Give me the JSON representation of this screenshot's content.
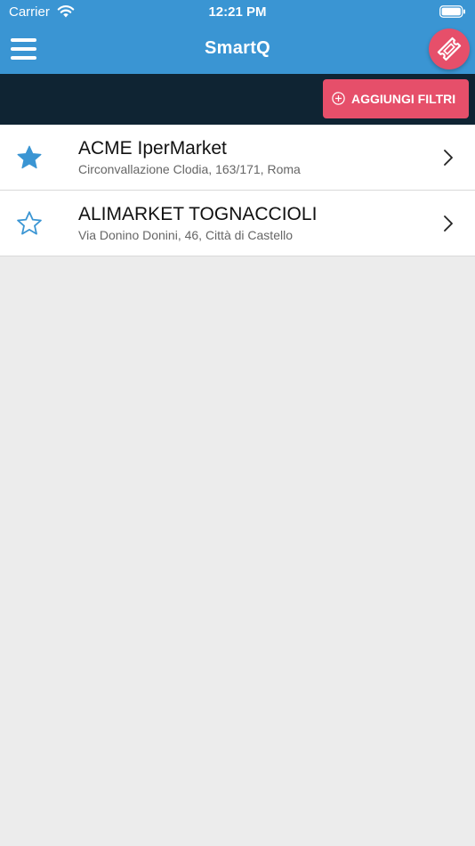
{
  "status_bar": {
    "carrier": "Carrier",
    "time": "12:21 PM"
  },
  "header": {
    "title": "SmartQ",
    "menu_icon": "hamburger-menu-icon",
    "ticket_icon": "ticket-icon",
    "accent_color": "#3a95d3",
    "action_color": "#e64f6a"
  },
  "filter_bar": {
    "add_filter_label": "AGGIUNGI FILTRI",
    "background_color": "#0f2433"
  },
  "stores": [
    {
      "name": "ACME IperMarket",
      "address": "Circonvallazione Clodia, 163/171, Roma",
      "favorite": true
    },
    {
      "name": "ALIMARKET TOGNACCIOLI",
      "address": "Via Donino Donini, 46, Città di Castello",
      "favorite": false
    }
  ],
  "colors": {
    "star": "#3a95d3",
    "list_background": "#ececec"
  }
}
